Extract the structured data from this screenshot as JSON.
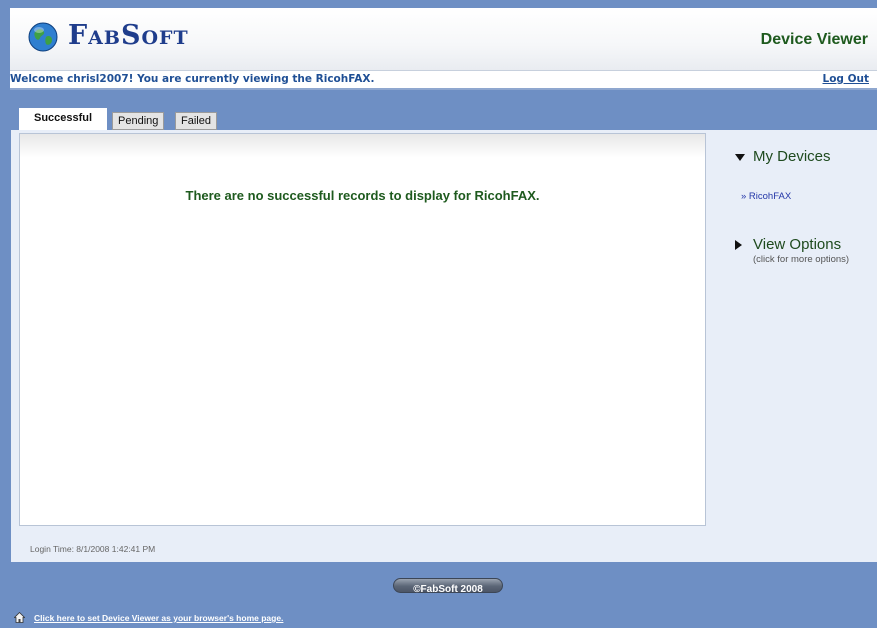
{
  "header": {
    "brand": "FabSoft",
    "app_title": "Device Viewer"
  },
  "welcome_bar": {
    "message": "Welcome chrisl2007! You are currently viewing the RicohFAX.",
    "logout_label": "Log Out"
  },
  "tabs": [
    {
      "label": "Successful",
      "active": true
    },
    {
      "label": "Pending",
      "active": false
    },
    {
      "label": "Failed",
      "active": false
    }
  ],
  "main": {
    "empty_message": "There are no successful records to display for RicohFAX.",
    "login_time": "Login Time: 8/1/2008 1:42:41 PM"
  },
  "sidebar": {
    "my_devices_title": "My Devices",
    "devices": [
      "» RicohFAX"
    ],
    "view_options_title": "View Options",
    "view_options_hint": "(click for more options)"
  },
  "footer": {
    "copyright": "©FabSoft 2008",
    "homepage_link": "Click here to set Device Viewer as your browser's home page."
  },
  "colors": {
    "background": "#6e8fc4",
    "title_green": "#1e5a1e",
    "link_blue": "#1f4f95"
  },
  "icons": {
    "logo": "globe-icon",
    "my_devices": "triangle-down-icon",
    "view_options": "triangle-right-icon",
    "homepage": "home-icon"
  }
}
